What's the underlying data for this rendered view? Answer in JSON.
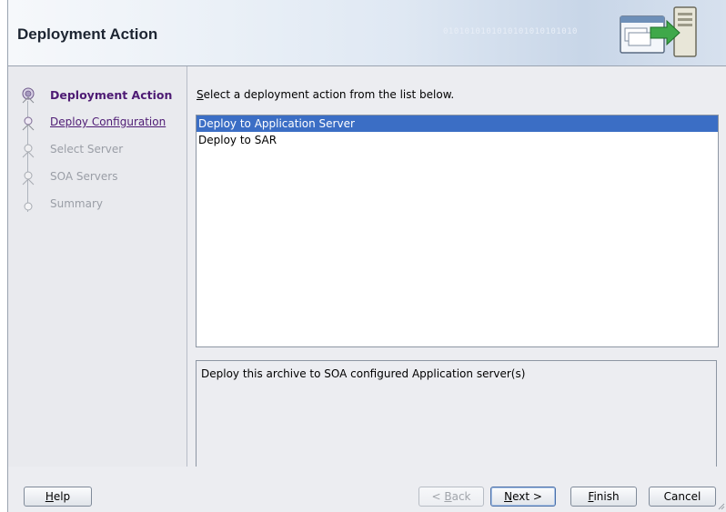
{
  "window": {
    "title": "Deployment Action"
  },
  "header": {
    "title": "Deployment Action",
    "binary_pattern": "0101010101010101010101010",
    "icon": "deploy-server-icon"
  },
  "steps": [
    {
      "label": "Deployment Action",
      "state": "current",
      "icon": "step-current-icon"
    },
    {
      "label": "Deploy Configuration",
      "state": "link",
      "icon": "step-icon"
    },
    {
      "label": "Select Server",
      "state": "disabled",
      "icon": "step-icon"
    },
    {
      "label": "SOA Servers",
      "state": "disabled",
      "icon": "step-icon"
    },
    {
      "label": "Summary",
      "state": "disabled",
      "icon": "step-end-icon"
    }
  ],
  "main": {
    "instruction": {
      "mnemonic": "S",
      "rest": "elect a deployment action from the list below."
    },
    "actions": [
      {
        "label": "Deploy to Application Server",
        "selected": true
      },
      {
        "label": "Deploy to SAR",
        "selected": false
      }
    ],
    "description": "Deploy this archive to SOA configured Application server(s)"
  },
  "buttons": {
    "help": {
      "mnemonic": "H",
      "rest": "elp"
    },
    "back": {
      "prefix": "< ",
      "mnemonic": "B",
      "rest": "ack",
      "enabled": false
    },
    "next": {
      "mnemonic": "N",
      "rest": "ext >",
      "default": true
    },
    "finish": {
      "mnemonic": "F",
      "rest": "inish"
    },
    "cancel": {
      "label": "Cancel"
    }
  },
  "colors": {
    "selection": "#3b6ec5",
    "step_active": "#4e1b74",
    "step_disabled": "#9a9ea6",
    "dialog_bg": "#ecedf1"
  }
}
